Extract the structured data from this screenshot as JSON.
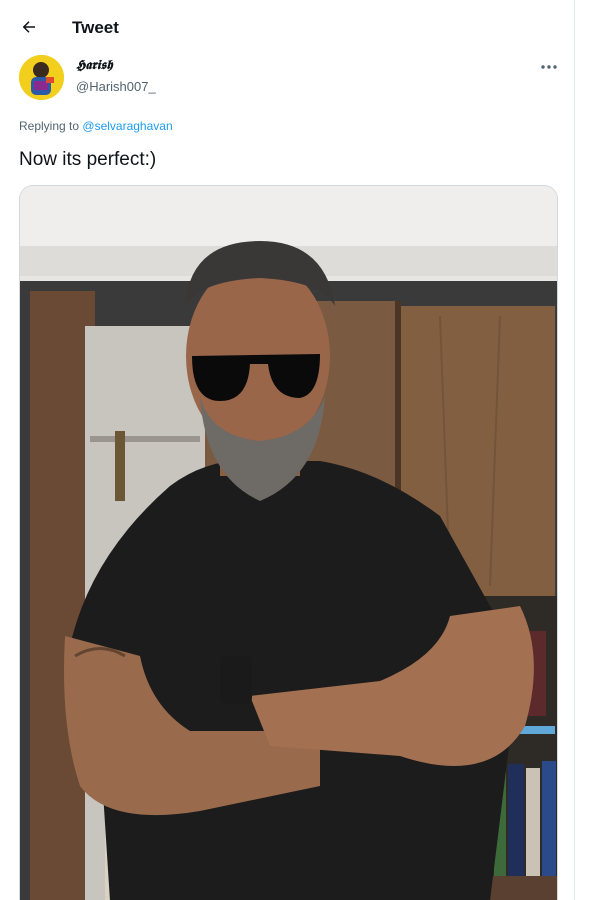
{
  "header": {
    "title": "Tweet",
    "back_icon": "arrow-left-icon"
  },
  "author": {
    "display_name": "𝕳𝖆𝖗𝖎𝖘𝖍",
    "handle": "@Harish007_"
  },
  "more_icon": "more-horizontal-icon",
  "tweet": {
    "replying_prefix": "Replying to",
    "replying_to": "@selvaraghavan",
    "text": "Now its perfect:)"
  },
  "colors": {
    "accent": "#1d9bf0",
    "secondary_text": "#536471",
    "primary_text": "#0f1419"
  }
}
